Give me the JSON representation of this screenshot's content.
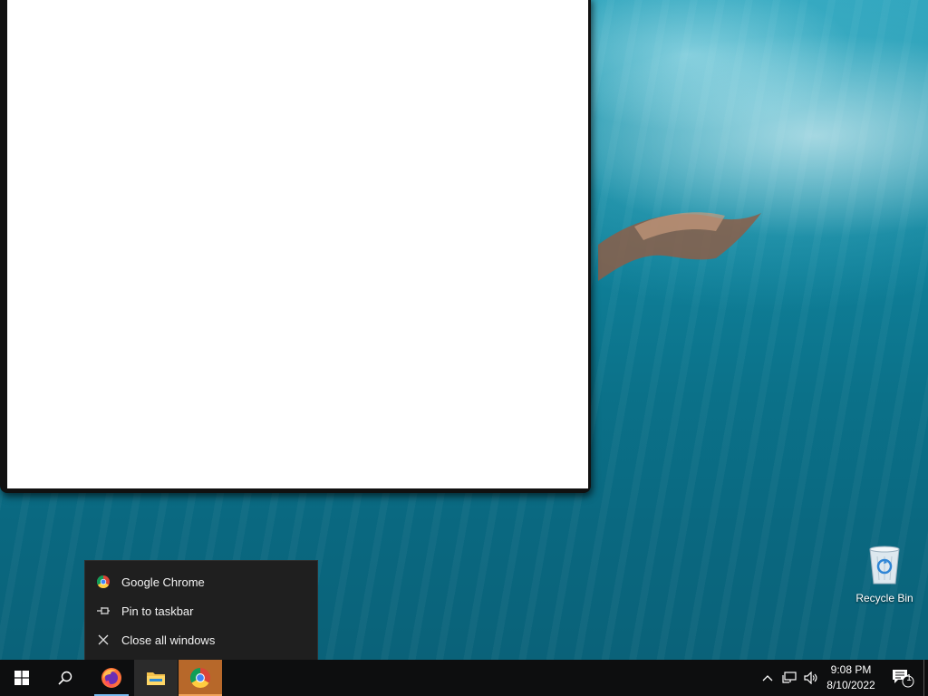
{
  "desktop": {
    "icons": [
      {
        "label": "Recycle Bin",
        "icon": "recycle-bin-icon"
      }
    ]
  },
  "window": {
    "state": "blank"
  },
  "jumplist": {
    "items": [
      {
        "label": "Google Chrome",
        "icon": "chrome-icon"
      },
      {
        "label": "Pin to taskbar",
        "icon": "pin-icon"
      },
      {
        "label": "Close all windows",
        "icon": "close-icon"
      }
    ]
  },
  "taskbar": {
    "start": {
      "icon": "windows-logo-icon"
    },
    "search": {
      "icon": "search-icon"
    },
    "apps": [
      {
        "name": "Firefox",
        "icon": "firefox-icon",
        "running": true
      },
      {
        "name": "File Explorer",
        "icon": "file-explorer-icon",
        "running": false
      },
      {
        "name": "Google Chrome",
        "icon": "chrome-icon",
        "running": true,
        "active": true
      }
    ],
    "tray": {
      "time": "9:08 PM",
      "date": "8/10/2022",
      "notification_count": "1"
    }
  },
  "colors": {
    "taskbar_bg": "#0d0e0f",
    "jumplist_bg": "#1f1f1f",
    "chrome_active": "#b7682a",
    "wallpaper_water": "#0f7f98"
  }
}
